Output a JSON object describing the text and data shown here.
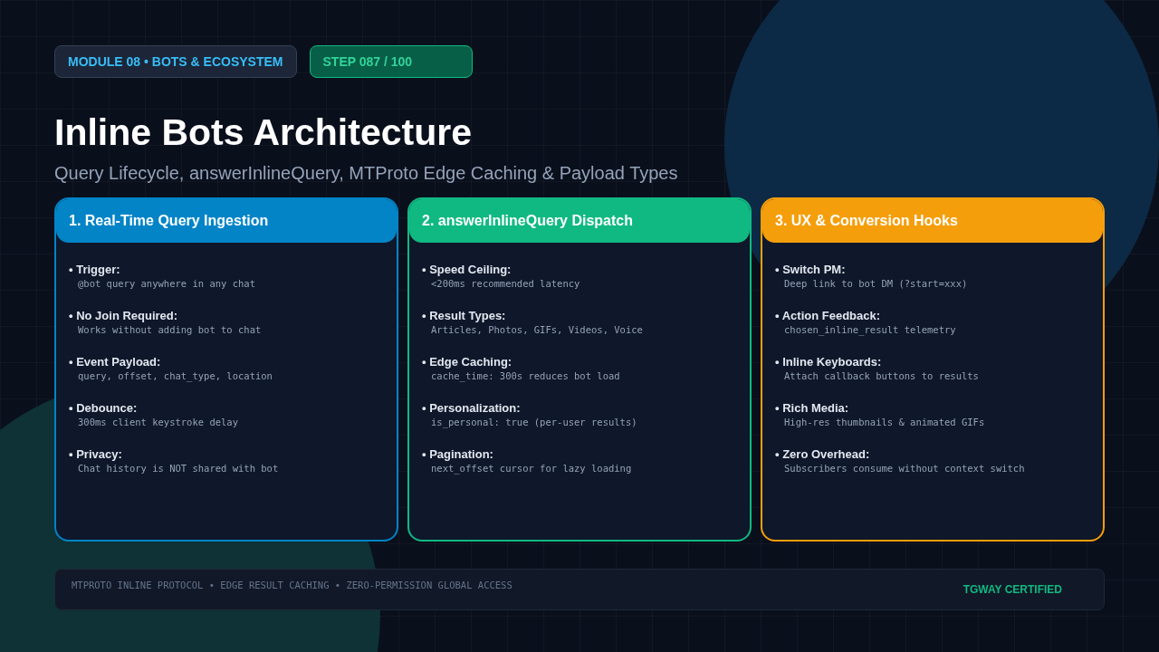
{
  "badges": [
    {
      "text": "MODULE 08 • BOTS & ECOSYSTEM",
      "kind": "module"
    },
    {
      "text": "STEP 087 / 100",
      "kind": "step"
    }
  ],
  "title": "Inline Bots Architecture",
  "subtitle": "Query Lifecycle, answerInlineQuery, MTProto Edge Caching & Payload Types",
  "cards": [
    {
      "title": "1. Real-Time Query Ingestion",
      "color": "#0284c7",
      "items": [
        {
          "label": "• Trigger:",
          "detail": "@bot query anywhere in any chat"
        },
        {
          "label": "• No Join Required:",
          "detail": "Works without adding bot to chat"
        },
        {
          "label": "• Event Payload:",
          "detail": "query, offset, chat_type, location"
        },
        {
          "label": "• Debounce:",
          "detail": "300ms client keystroke delay"
        },
        {
          "label": "• Privacy:",
          "detail": "Chat history is NOT shared with bot"
        }
      ]
    },
    {
      "title": "2. answerInlineQuery Dispatch",
      "color": "#10b981",
      "items": [
        {
          "label": "• Speed Ceiling:",
          "detail": "<200ms recommended latency"
        },
        {
          "label": "• Result Types:",
          "detail": "Articles, Photos, GIFs, Videos, Voice"
        },
        {
          "label": "• Edge Caching:",
          "detail": "cache_time: 300s reduces bot load"
        },
        {
          "label": "• Personalization:",
          "detail": "is_personal: true (per-user results)"
        },
        {
          "label": "• Pagination:",
          "detail": "next_offset cursor for lazy loading"
        }
      ]
    },
    {
      "title": "3. UX & Conversion Hooks",
      "color": "#f59e0b",
      "items": [
        {
          "label": "• Switch PM:",
          "detail": "Deep link to bot DM (?start=xxx)"
        },
        {
          "label": "• Action Feedback:",
          "detail": "chosen_inline_result telemetry"
        },
        {
          "label": "• Inline Keyboards:",
          "detail": "Attach callback buttons to results"
        },
        {
          "label": "• Rich Media:",
          "detail": "High-res thumbnails & animated GIFs"
        },
        {
          "label": "• Zero Overhead:",
          "detail": "Subscribers consume without context switch"
        }
      ]
    }
  ],
  "footer": {
    "text": "MTPROTO INLINE PROTOCOL • EDGE RESULT CACHING • ZERO-PERMISSION GLOBAL ACCESS",
    "badge": "TGWAY CERTIFIED"
  }
}
